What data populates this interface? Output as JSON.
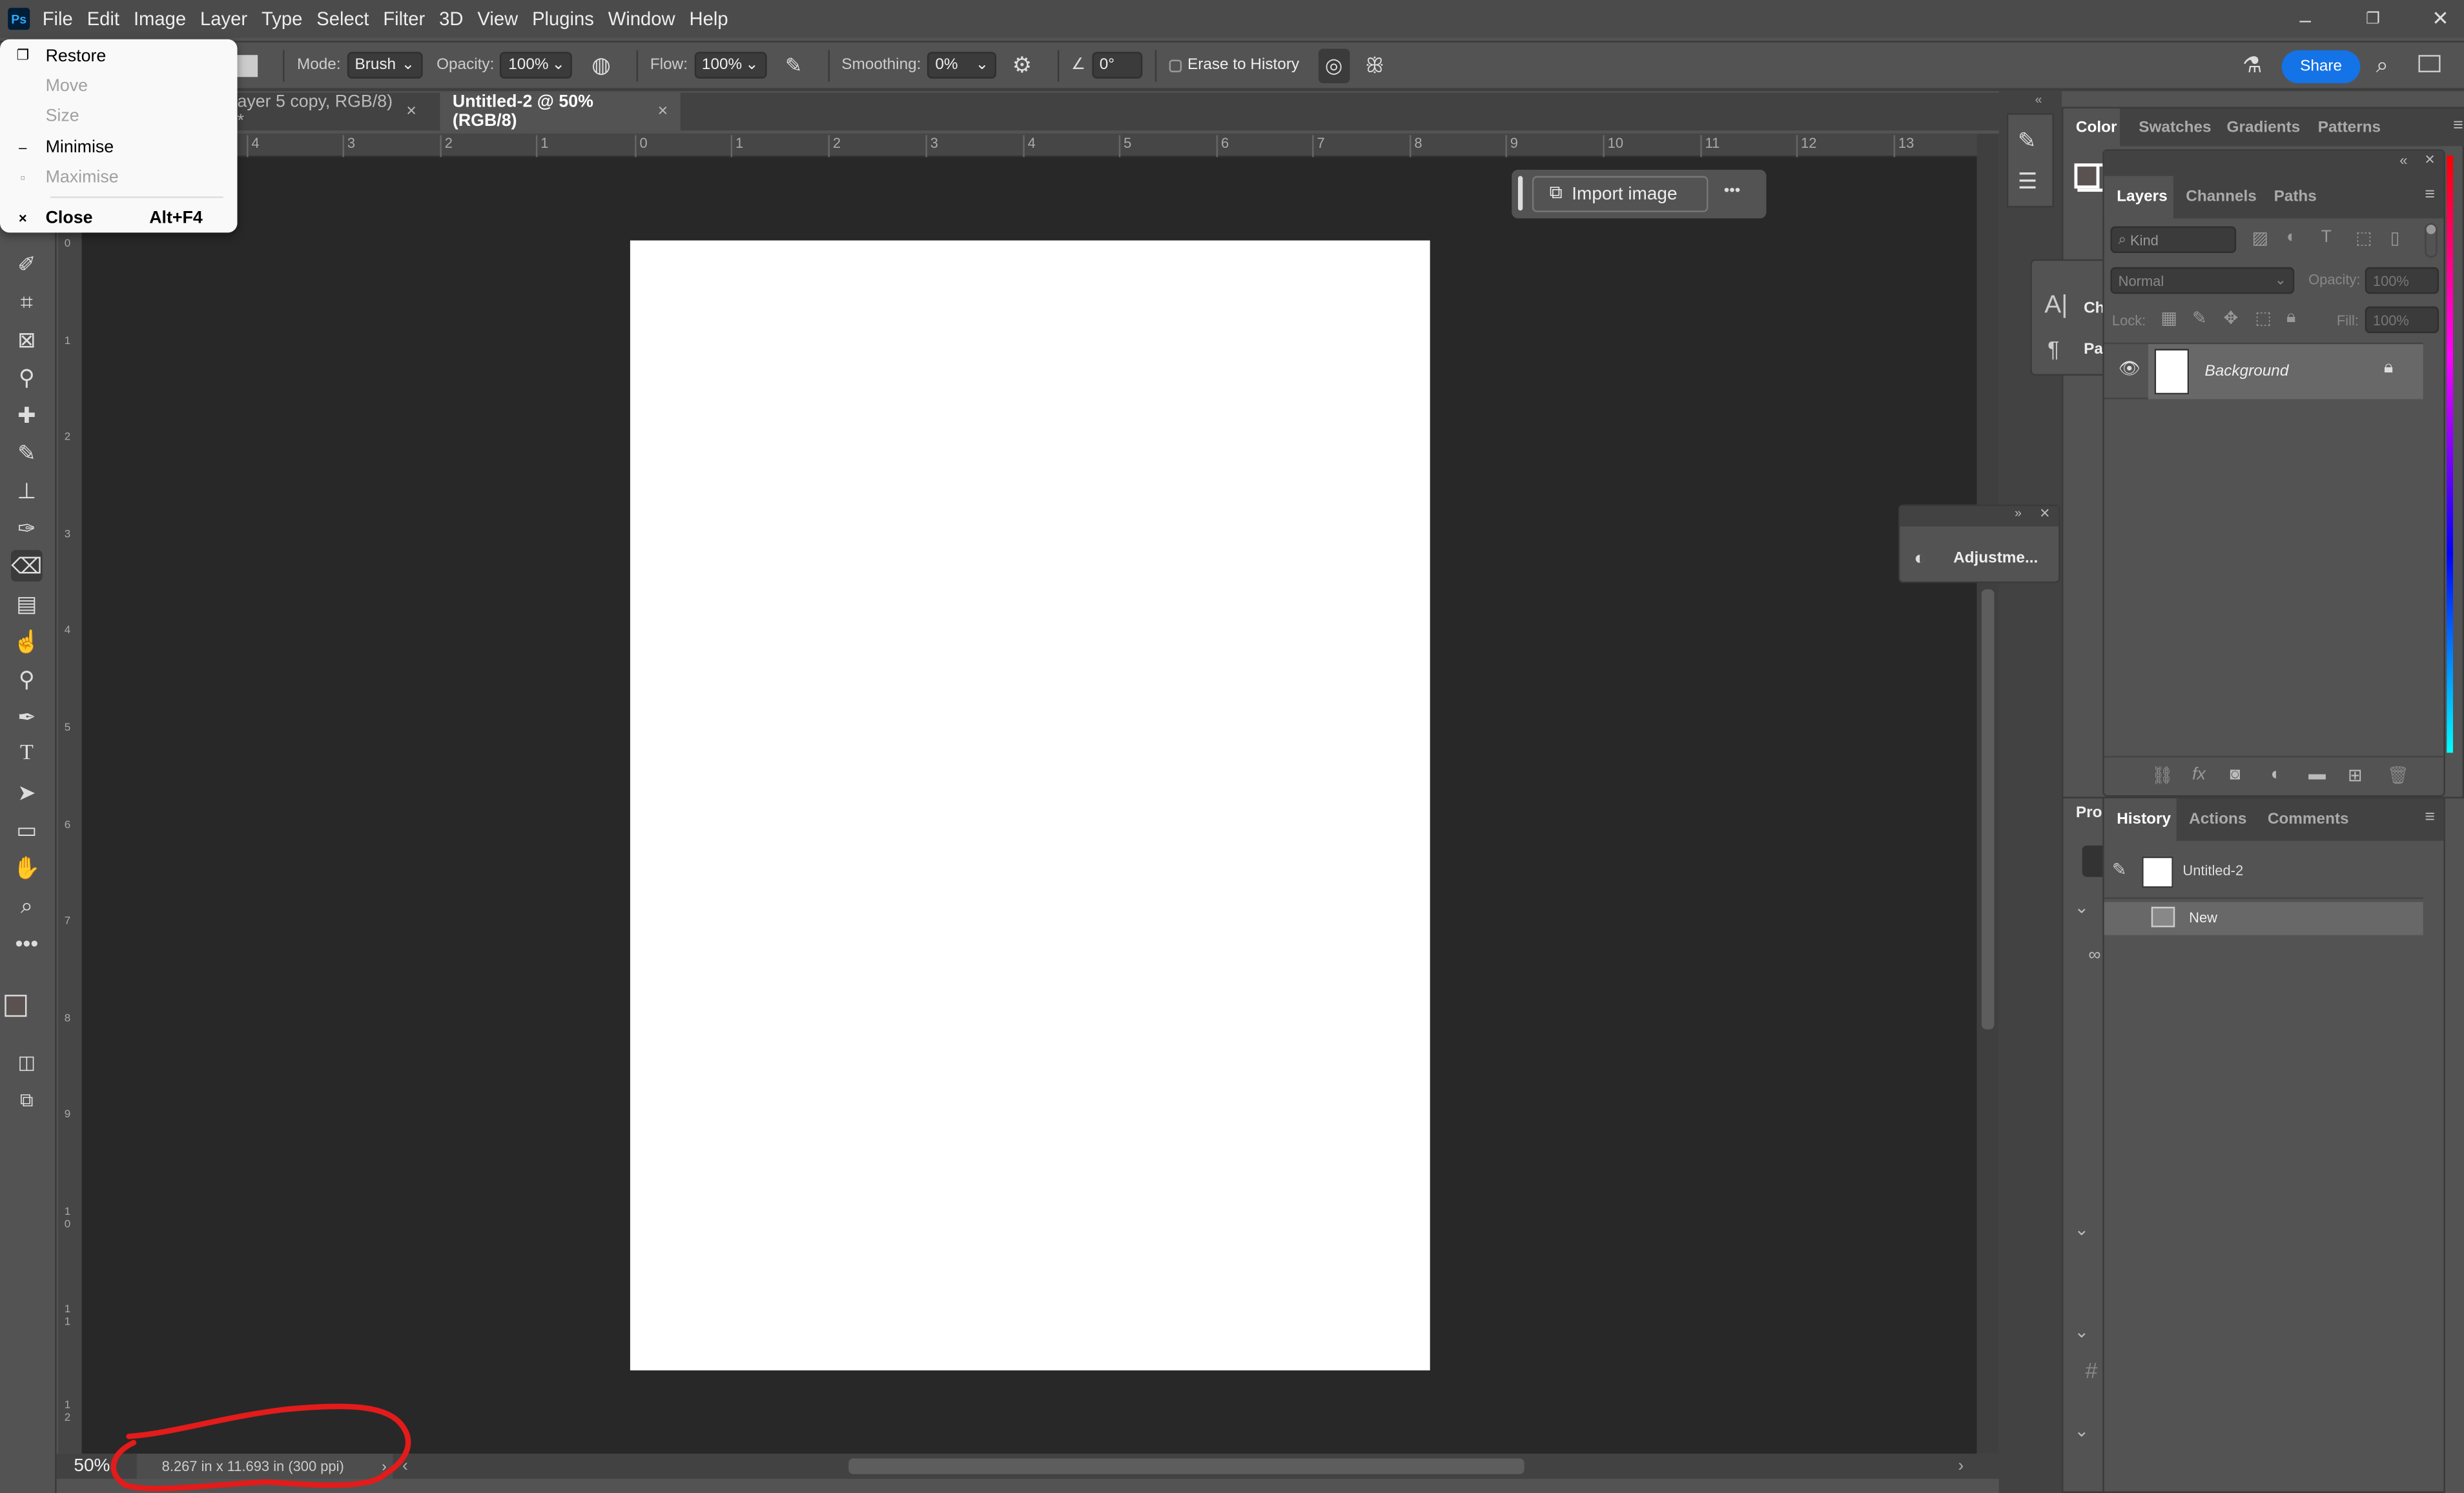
{
  "app": {
    "logo": "Ps",
    "menu": [
      "File",
      "Edit",
      "Image",
      "Layer",
      "Type",
      "Select",
      "Filter",
      "3D",
      "View",
      "Plugins",
      "Window",
      "Help"
    ],
    "window_controls": {
      "minimize": "–",
      "restore": "❐",
      "close": "✕"
    }
  },
  "system_menu": {
    "items": [
      {
        "label": "Restore",
        "icon": "restore-icon",
        "enabled": true
      },
      {
        "label": "Move",
        "enabled": false
      },
      {
        "label": "Size",
        "enabled": false
      },
      {
        "label": "Minimise",
        "icon": "minimize-icon",
        "enabled": true
      },
      {
        "label": "Maximise",
        "icon": "maximize-icon",
        "enabled": false
      },
      {
        "label": "Close",
        "icon": "close-icon",
        "shortcut": "Alt+F4",
        "enabled": true
      }
    ]
  },
  "options": {
    "mode_label": "Mode:",
    "mode": "Brush",
    "opacity_label": "Opacity:",
    "opacity": "100%",
    "flow_label": "Flow:",
    "flow": "100%",
    "smoothing_label": "Smoothing:",
    "smoothing": "0%",
    "angle": "0°",
    "erase_to_history": "Erase to History",
    "erase_to_history_checked": false,
    "share": "Share"
  },
  "tabs": [
    {
      "label": "ayer 5 copy, RGB/8) *",
      "active": false
    },
    {
      "label": "Untitled-2 @ 50% (RGB/8)",
      "active": true
    }
  ],
  "ruler": {
    "top": [
      "4",
      "3",
      "2",
      "1",
      "0",
      "1",
      "2",
      "3",
      "4",
      "5",
      "6",
      "7",
      "8",
      "9",
      "10",
      "11",
      "12",
      "13"
    ],
    "left": [
      "0",
      "1",
      "2",
      "3",
      "4",
      "5",
      "6",
      "7",
      "8",
      "9",
      "1 0",
      "1 1",
      "1 2"
    ]
  },
  "contextual_bar": {
    "import": "Import image",
    "more": "•••"
  },
  "status": {
    "zoom": "50%",
    "doc_info": "8.267 in x 11.693 in (300 ppi)"
  },
  "color_panel": {
    "tabs": [
      "Color",
      "Swatches",
      "Gradients",
      "Patterns"
    ],
    "foreground": "#5a5251",
    "background": "#000000"
  },
  "layers_panel": {
    "tabs": [
      "Layers",
      "Channels",
      "Paths"
    ],
    "filter": "Kind",
    "blend_mode": "Normal",
    "opacity_label": "Opacity:",
    "opacity": "100%",
    "lock_label": "Lock:",
    "fill_label": "Fill:",
    "fill": "100%",
    "layers": [
      {
        "name": "Background",
        "visible": true,
        "locked": true
      }
    ]
  },
  "char_panel": {
    "items": [
      "Ch",
      "Pa"
    ]
  },
  "adjustments_panel": {
    "label": "Adjustme..."
  },
  "properties_panel": {
    "tab": "Prop"
  },
  "history_panel": {
    "tabs": [
      "History",
      "Actions",
      "Comments"
    ],
    "snapshot": "Untitled-2",
    "items": [
      "New"
    ]
  },
  "colors": {
    "accent": "#1473e6",
    "annotation": "#e31b1b"
  }
}
